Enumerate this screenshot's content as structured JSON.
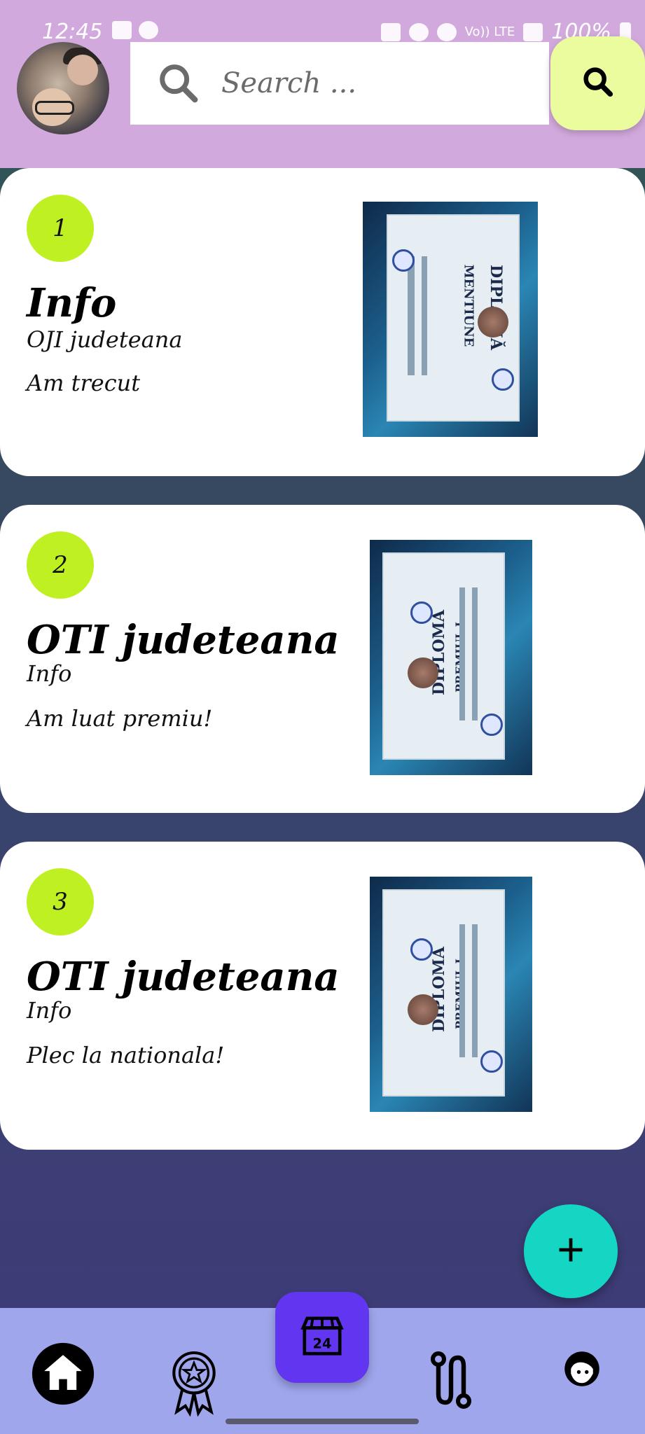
{
  "status_bar": {
    "time": "12:45",
    "network_label": "Vo)) LTE",
    "battery": "100%"
  },
  "header": {
    "search_placeholder": "Search ...",
    "accent_color": "#eafc9e",
    "header_color": "#d2a9dc"
  },
  "cards": [
    {
      "number": "1",
      "title": "Info",
      "subtitle": "OJI judeteana",
      "description": "Am trecut",
      "thumbnail_icon": "diploma-photo"
    },
    {
      "number": "2",
      "title": "OTI judeteana",
      "subtitle": "Info",
      "description": "Am luat premiu!",
      "thumbnail_icon": "diploma-photo"
    },
    {
      "number": "3",
      "title": "OTI judeteana",
      "subtitle": "Info",
      "description": "Plec la nationala!",
      "thumbnail_icon": "diploma-photo"
    }
  ],
  "thumbnails": {
    "diploma_word": "DIPLOMĂ",
    "mention_word": "MENTIUNE",
    "prize_word": "PREMIUL I"
  },
  "fab": {
    "icon": "plus-icon",
    "color": "#14d6c3"
  },
  "bottom_nav": {
    "items": [
      {
        "icon": "home-icon"
      },
      {
        "icon": "award-ribbon-icon"
      },
      {
        "icon": "store-24-icon"
      },
      {
        "icon": "route-icon"
      },
      {
        "icon": "profile-face-icon"
      }
    ],
    "color": "#9fa6ec",
    "center_color": "#6236f0"
  }
}
